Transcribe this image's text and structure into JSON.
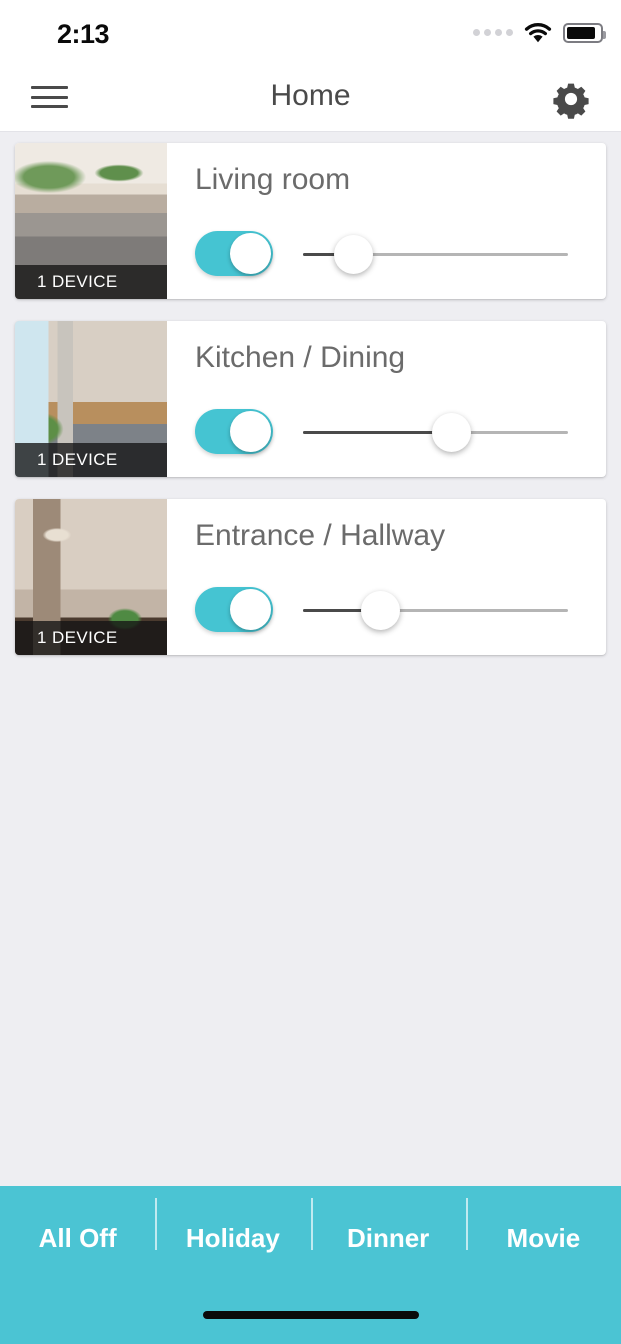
{
  "status_bar": {
    "time": "2:13",
    "signal_icon": "signal-dots-icon",
    "wifi_icon": "wifi-icon",
    "battery_icon": "battery-icon",
    "battery_level_pct": 88
  },
  "nav_bar": {
    "menu_icon": "hamburger-menu-icon",
    "title": "Home",
    "settings_icon": "gear-icon"
  },
  "rooms": [
    {
      "name": "Living room",
      "device_count_label": "1 DEVICE",
      "power_on": true,
      "brightness_pct": 19,
      "thumbnail": "living-room-photo"
    },
    {
      "name": "Kitchen / Dining",
      "device_count_label": "1 DEVICE",
      "power_on": true,
      "brightness_pct": 56,
      "thumbnail": "kitchen-dining-photo"
    },
    {
      "name": "Entrance / Hallway",
      "device_count_label": "1 DEVICE",
      "power_on": true,
      "brightness_pct": 29,
      "thumbnail": "entrance-hallway-photo"
    }
  ],
  "scene_bar": {
    "scenes": [
      {
        "label": "All Off"
      },
      {
        "label": "Holiday"
      },
      {
        "label": "Dinner"
      },
      {
        "label": "Movie"
      }
    ]
  },
  "colors": {
    "accent_teal": "#4bc4d3",
    "toggle_on": "#45c4d2",
    "page_background": "#eeeef2",
    "card_background": "#ffffff",
    "title_text": "#6b6b6b",
    "slider_fill": "#4a4a4a",
    "slider_track": "#b5b5b5"
  }
}
